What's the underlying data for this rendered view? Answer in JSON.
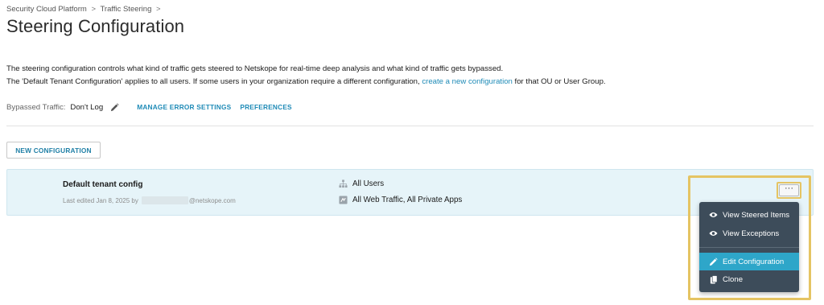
{
  "breadcrumb": {
    "items": [
      "Security Cloud Platform",
      "Traffic Steering"
    ],
    "separator": ">"
  },
  "page": {
    "title": "Steering Configuration"
  },
  "description": {
    "line1": "The steering configuration controls what kind of traffic gets steered to Netskope for real-time deep analysis and what kind of traffic gets bypassed.",
    "line2_before": "The 'Default Tenant Configuration' applies to all users. If some users in your organization require a different configuration, ",
    "line2_link": "create a new configuration",
    "line2_after": " for that OU or User Group."
  },
  "bypass": {
    "label": "Bypassed Traffic:",
    "value": "Don't Log",
    "manage_error_settings": "MANAGE ERROR SETTINGS",
    "preferences": "PREFERENCES"
  },
  "actions": {
    "new_configuration": "NEW CONFIGURATION"
  },
  "configs": [
    {
      "name": "Default tenant config",
      "meta_prefix": "Last edited Jan 8, 2025 by",
      "meta_suffix": "@netskope.com",
      "users": "All Users",
      "traffic": "All Web Traffic, All Private Apps",
      "more_label": "···"
    }
  ],
  "menu": {
    "items": [
      {
        "label": "View Steered Items",
        "icon": "eye-icon"
      },
      {
        "label": "View Exceptions",
        "icon": "eye-icon"
      },
      {
        "label": "Edit Configuration",
        "icon": "pencil-icon",
        "active": true
      },
      {
        "label": "Clone",
        "icon": "copy-icon"
      }
    ]
  },
  "colors": {
    "accent": "#1f8bb7",
    "row_bg": "#e6f4f9",
    "menu_bg": "#3d4c5a",
    "menu_active": "#2ea6c9",
    "highlight": "#e5c463"
  }
}
